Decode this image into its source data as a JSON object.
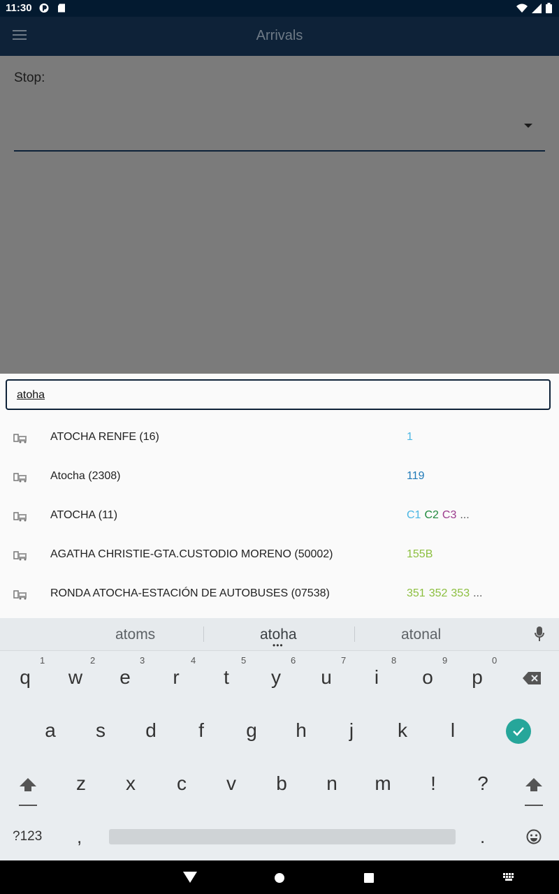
{
  "status_bar": {
    "time": "11:30"
  },
  "app_bar": {
    "title": "Arrivals",
    "menu_icon": "hamburger-menu-icon"
  },
  "form": {
    "stop_label": "Stop:",
    "stop_value": ""
  },
  "search": {
    "value": "atoha"
  },
  "results": [
    {
      "name": "ATOCHA RENFE (16)",
      "lines": [
        {
          "text": "1",
          "color": "#4ab6e3"
        }
      ]
    },
    {
      "name": "Atocha (2308)",
      "lines": [
        {
          "text": "119",
          "color": "#1f7ab8"
        }
      ]
    },
    {
      "name": "ATOCHA (11)",
      "lines": [
        {
          "text": "C1",
          "color": "#4ab6e3"
        },
        {
          "text": "C2",
          "color": "#1f8a3d"
        },
        {
          "text": "C3",
          "color": "#9b3a8c"
        },
        {
          "text": "...",
          "color": "#555555"
        }
      ]
    },
    {
      "name": "AGATHA CHRISTIE-GTA.CUSTODIO MORENO (50002)",
      "lines": [
        {
          "text": "155B",
          "color": "#8cbf3f"
        }
      ]
    },
    {
      "name": "RONDA ATOCHA-ESTACIÓN DE AUTOBUSES (07538)",
      "lines": [
        {
          "text": "351",
          "color": "#8cbf3f"
        },
        {
          "text": "352",
          "color": "#8cbf3f"
        },
        {
          "text": "353",
          "color": "#8cbf3f"
        },
        {
          "text": "...",
          "color": "#555555"
        }
      ]
    }
  ],
  "keyboard": {
    "suggestions": [
      "atoms",
      "atoha",
      "atonal"
    ],
    "row1": [
      "q",
      "w",
      "e",
      "r",
      "t",
      "y",
      "u",
      "i",
      "o",
      "p"
    ],
    "row1_hints": [
      "1",
      "2",
      "3",
      "4",
      "5",
      "6",
      "7",
      "8",
      "9",
      "0"
    ],
    "row2": [
      "a",
      "s",
      "d",
      "f",
      "g",
      "h",
      "j",
      "k",
      "l"
    ],
    "row3": [
      "z",
      "x",
      "c",
      "v",
      "b",
      "n",
      "m",
      "!",
      "?"
    ],
    "symbols_key": "?123",
    "comma_key": ",",
    "period_key": ".",
    "enter_color": "#26a69a"
  },
  "colors": {
    "status_bar": "#031a30",
    "app_bar": "#0e2238",
    "accent": "#0e2238"
  }
}
